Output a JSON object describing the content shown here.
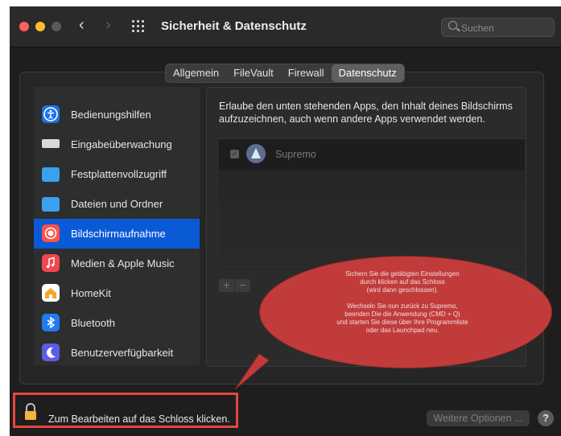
{
  "window": {
    "title": "Sicherheit & Datenschutz",
    "search_placeholder": "Suchen"
  },
  "tabs": [
    {
      "label": "Allgemein",
      "active": false
    },
    {
      "label": "FileVault",
      "active": false
    },
    {
      "label": "Firewall",
      "active": false
    },
    {
      "label": "Datenschutz",
      "active": true
    }
  ],
  "sidebar": {
    "items": [
      {
        "label": "Bedienungshilfen",
        "icon": "accessibility-icon",
        "color": "#1a73e8",
        "active": false
      },
      {
        "label": "Eingabeüberwachung",
        "icon": "keyboard-icon",
        "color": "#d9d9d9",
        "active": false
      },
      {
        "label": "Festplattenvollzugriff",
        "icon": "folder-icon",
        "color": "#3aa0f0",
        "active": false
      },
      {
        "label": "Dateien und Ordner",
        "icon": "folder-icon",
        "color": "#3aa0f0",
        "active": false
      },
      {
        "label": "Bildschirmaufnahme",
        "icon": "screen-recording-icon",
        "color": "#ff5148",
        "active": true
      },
      {
        "label": "Medien & Apple Music",
        "icon": "music-icon",
        "color": "#f2454f",
        "active": false
      },
      {
        "label": "HomeKit",
        "icon": "home-icon",
        "color": "#ffffff",
        "active": false
      },
      {
        "label": "Bluetooth",
        "icon": "bluetooth-icon",
        "color": "#1f7cf0",
        "active": false
      },
      {
        "label": "Benutzerverfügbarkeit",
        "icon": "moon-icon",
        "color": "#5e5ce6",
        "active": false
      }
    ]
  },
  "privacy": {
    "description": "Erlaube den unten stehenden Apps, den Inhalt deines Bildschirms aufzuzeichnen, auch wenn andere Apps verwendet werden.",
    "apps": [
      {
        "name": "Supremo",
        "checked": true
      }
    ],
    "add_label": "+",
    "remove_label": "−"
  },
  "callout": {
    "line1": "Sichern Sie die getätigten Einstellungen",
    "line2": "durch klicken auf das Schloss",
    "line3": "(wird dann geschlossen).",
    "line4": "Wechseln Sie nun zurück zu Supremo,",
    "line5": "beenden Die die Anwendung (CMD + Q)",
    "line6": "und starten Sie diese über Ihre Programmliste",
    "line7": "oder das Launchpad neu."
  },
  "footer": {
    "lock_label": "Zum Bearbeiten auf das Schloss klicken.",
    "more_options_label": "Weitere Optionen ...",
    "help_label": "?"
  }
}
